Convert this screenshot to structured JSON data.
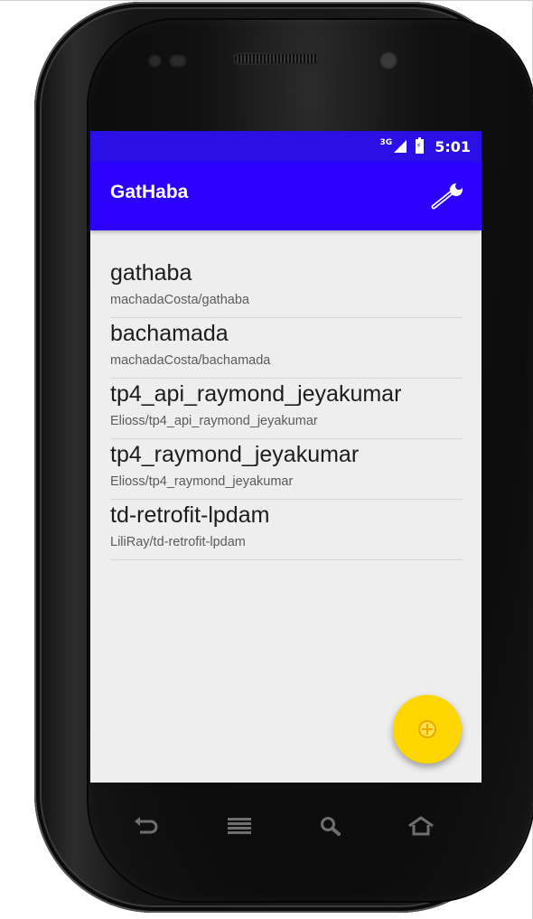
{
  "status_bar": {
    "network": "3G",
    "time": "5:01"
  },
  "app_bar": {
    "title": "GatHaba",
    "settings_icon": "wrench-icon"
  },
  "repositories": [
    {
      "name": "gathaba",
      "full_name": "machadaCosta/gathaba"
    },
    {
      "name": "bachamada",
      "full_name": "machadaCosta/bachamada"
    },
    {
      "name": "tp4_api_raymond_jeyakumar",
      "full_name": "Elioss/tp4_api_raymond_jeyakumar"
    },
    {
      "name": "tp4_raymond_jeyakumar",
      "full_name": "Elioss/tp4_raymond_jeyakumar"
    },
    {
      "name": "td-retrofit-lpdam",
      "full_name": "LiliRay/td-retrofit-lpdam"
    }
  ],
  "fab": {
    "icon": "add-circle-icon",
    "color": "#ffd600"
  },
  "navigation": [
    "back-icon",
    "menu-icon",
    "search-icon",
    "home-icon"
  ],
  "colors": {
    "primary": "#2c00ff",
    "status_bar": "#2a10e6",
    "accent": "#ffd600"
  }
}
